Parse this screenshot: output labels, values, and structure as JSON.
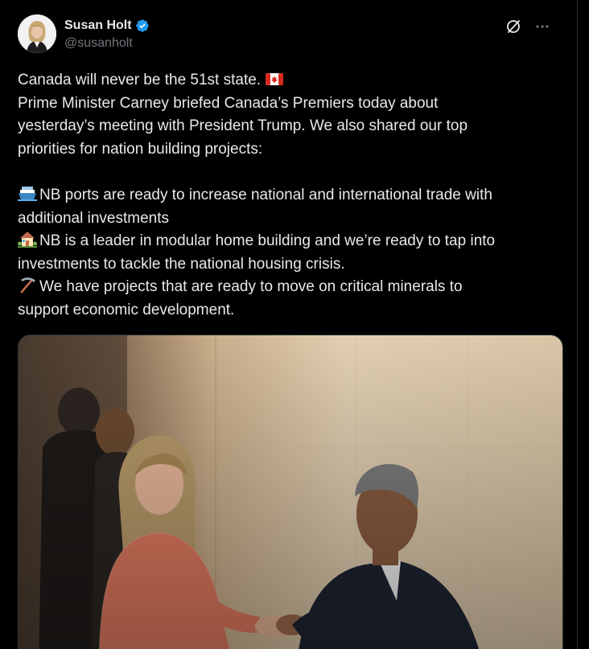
{
  "author": {
    "display_name": "Susan Holt",
    "handle": "@susanholt",
    "verified": true
  },
  "icons": {
    "verified": "verified-badge-icon",
    "grok": "grok-icon",
    "more": "more-options-icon",
    "canada_flag": "canada-flag-icon",
    "ship": "ship-icon",
    "house": "house-with-garden-icon",
    "pick": "pick-icon"
  },
  "tweet": {
    "line1": "Canada will never be the 51st state.",
    "line2": "Prime Minister Carney briefed Canada’s Premiers today about",
    "line3": "yesterday’s meeting with President Trump. We also shared our top",
    "line4": "priorities for nation building projects:",
    "bullet1_a": "NB ports are ready to increase national and international trade with",
    "bullet1_b": "additional investments",
    "bullet2_a": "NB is a leader in modular home building and we’re ready to tap into",
    "bullet2_b": "investments to tackle the national housing crisis.",
    "bullet3_a": "We have projects that are ready to move on critical minerals to",
    "bullet3_b": "support economic development."
  },
  "colors": {
    "background": "#000000",
    "text": "#e7e9ea",
    "secondary_text": "#71767b",
    "verified_blue": "#1d9bf0",
    "border": "#2f3336"
  }
}
